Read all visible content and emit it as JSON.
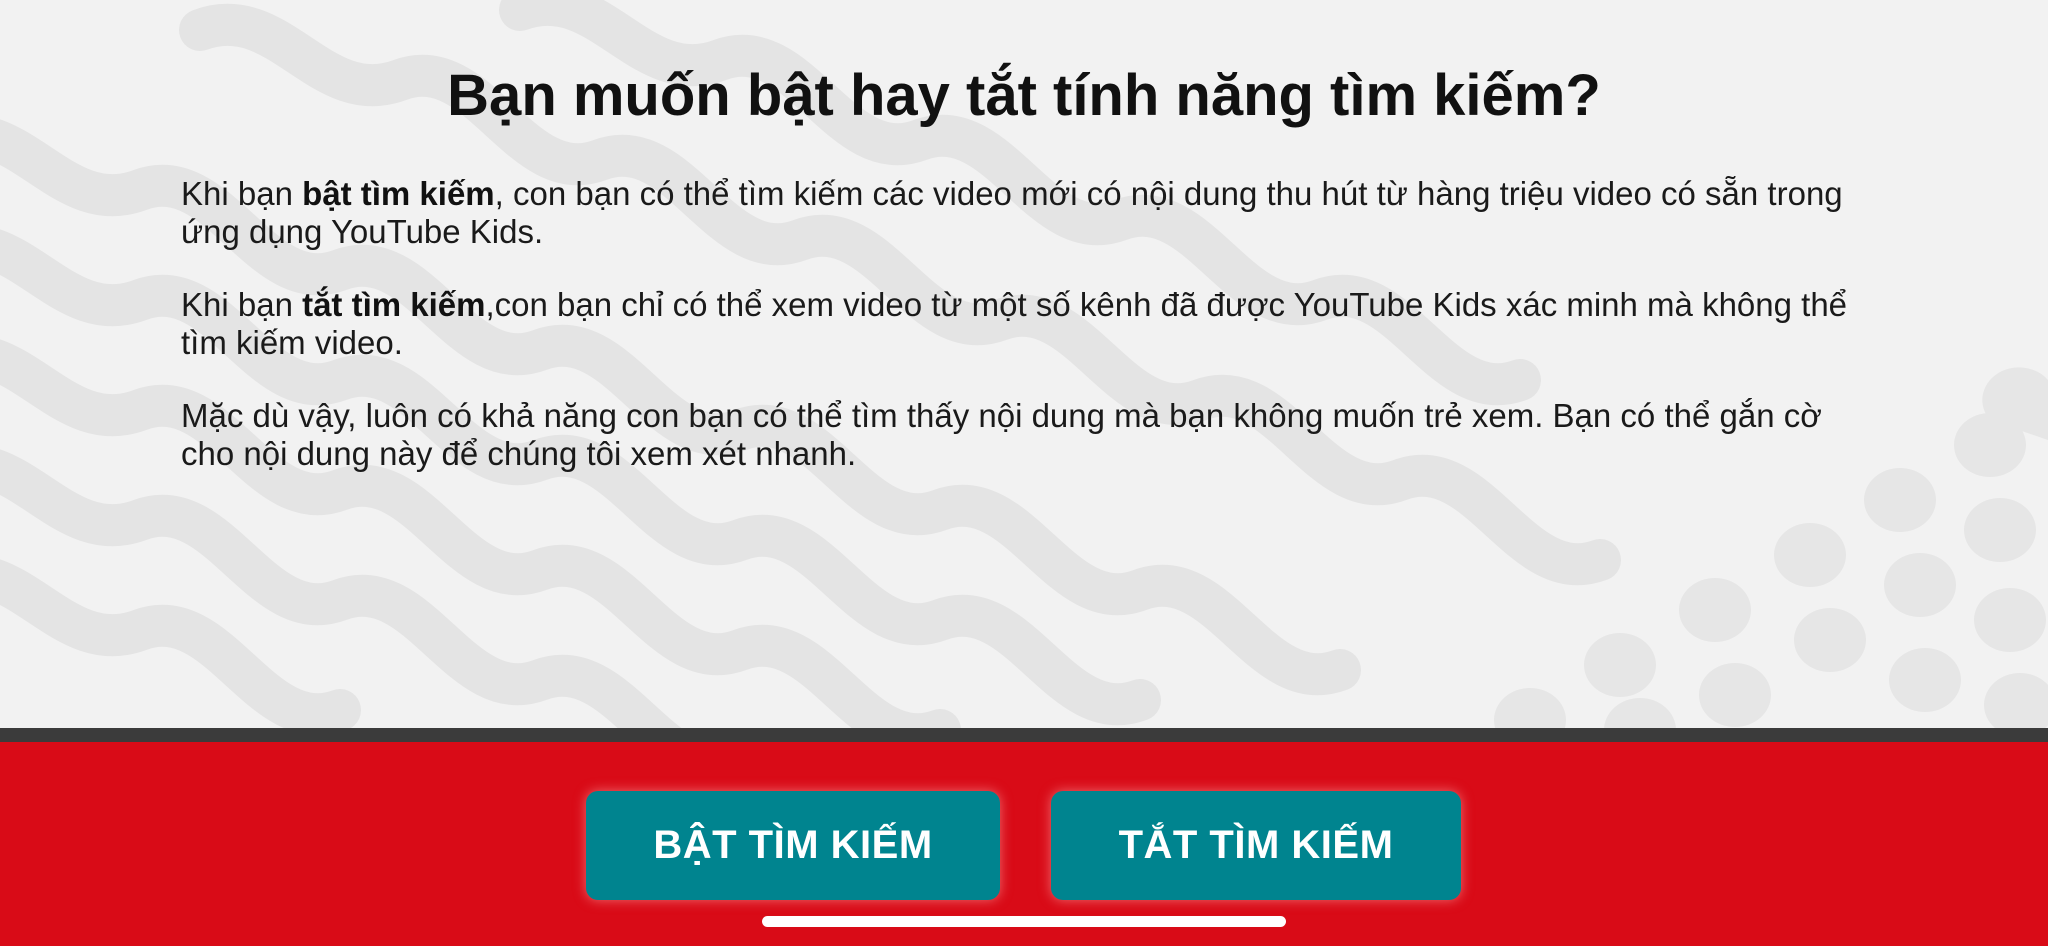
{
  "page": {
    "title": "Bạn muốn bật hay tắt tính năng tìm kiếm?",
    "paragraph_on": {
      "prefix": "Khi bạn ",
      "emphasis": "bật tìm kiếm",
      "suffix": ", con bạn có thể tìm kiếm các video mới có nội dung thu hút từ hàng triệu video có sẵn trong ứng dụng YouTube Kids."
    },
    "paragraph_off": {
      "prefix": "Khi bạn ",
      "emphasis": "tắt tìm kiếm",
      "suffix": ",con bạn chỉ có thể xem video từ một số kênh đã được YouTube Kids xác minh mà không thể tìm kiếm video."
    },
    "paragraph_note": "Mặc dù vậy, luôn có khả năng con bạn có thể tìm thấy nội dung mà bạn không muốn trẻ xem. Bạn có thể gắn cờ cho nội dung này để chúng tôi xem xét nhanh."
  },
  "actions": {
    "turn_on_label": "BẬT TÌM KIẾM",
    "turn_off_label": "TẮT TÌM KIẾM"
  },
  "colors": {
    "background": "#f2f2f2",
    "pattern": "#e3e3e3",
    "bottom_bar": "#d90b17",
    "divider": "#3b3b3b",
    "button": "#00848f",
    "button_text": "#ffffff"
  }
}
